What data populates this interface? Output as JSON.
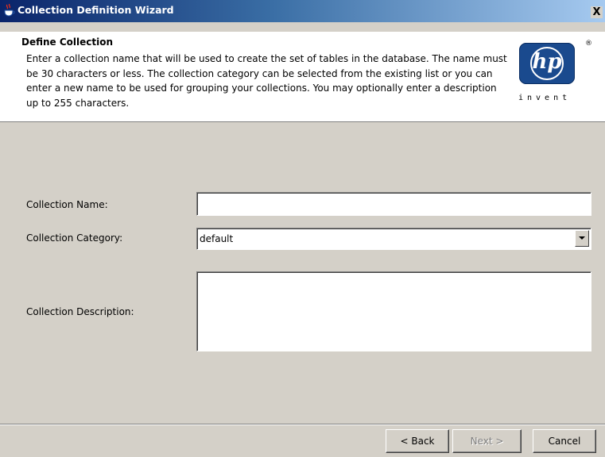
{
  "window": {
    "title": "Collection Definition Wizard",
    "close_label": "X",
    "app_icon": "java-coffee-cup-icon"
  },
  "header": {
    "title": "Define Collection",
    "description": "Enter a collection name that will be used to create the set of tables in the database. The name must be 30 characters or less. The collection category can be selected from the existing list or you can enter a new name to be used for grouping your collections. You may optionally enter a description up to 255 characters.",
    "logo": {
      "text": "hp",
      "registered": "®",
      "tagline": "invent",
      "color": "#1a4a8e"
    }
  },
  "form": {
    "name": {
      "label": "Collection Name:",
      "value": ""
    },
    "category": {
      "label": "Collection Category:",
      "value": "default"
    },
    "description": {
      "label": "Collection Description:",
      "value": ""
    }
  },
  "buttons": {
    "back": "< Back",
    "next": "Next >",
    "cancel": "Cancel",
    "next_enabled": false
  }
}
